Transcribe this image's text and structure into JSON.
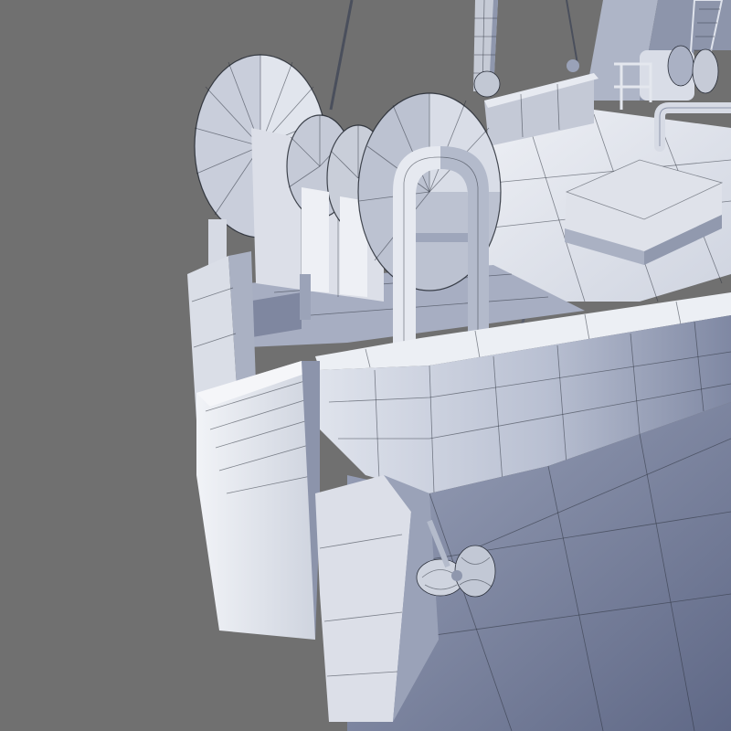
{
  "scene": {
    "subject": "wireframe-3d-ship-stern",
    "colors": {
      "background": "#707070",
      "surface_light": "#e6e9f0",
      "surface_mid": "#c9cedb",
      "surface_dark": "#8f97ad",
      "surface_shadow": "#6b7391",
      "wire": "#2a2f3a"
    }
  }
}
